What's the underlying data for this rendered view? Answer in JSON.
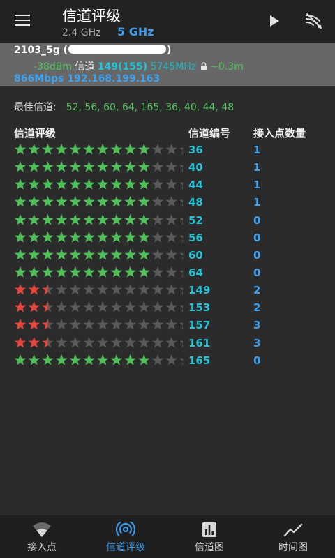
{
  "header": {
    "title": "信道评级",
    "band_24": "2.4 GHz",
    "band_5": "5 GHz",
    "icons": [
      "menu-icon",
      "play-icon",
      "wifi-scan-icon"
    ]
  },
  "connection": {
    "ssid_prefix": "2103_5g (",
    "ssid_suffix": ")",
    "signal": "-38dBm",
    "channel_label": "信道",
    "channel_value": "149(155)",
    "frequency": "5745MHz",
    "distance": "~0.3m",
    "link_speed": "866Mbps",
    "ip": "192.168.199.163"
  },
  "best_channels": {
    "label": "最佳信道:",
    "values": "52, 56, 60, 64, 165, 36, 40, 44, 48"
  },
  "table": {
    "col_rating": "信道评级",
    "col_channel": "信道编号",
    "col_count": "接入点数量",
    "rows": [
      {
        "rating": 10,
        "channel": "36",
        "count": "1"
      },
      {
        "rating": 10,
        "channel": "40",
        "count": "1"
      },
      {
        "rating": 10,
        "channel": "44",
        "count": "1"
      },
      {
        "rating": 10,
        "channel": "48",
        "count": "1"
      },
      {
        "rating": 10,
        "channel": "52",
        "count": "0"
      },
      {
        "rating": 10,
        "channel": "56",
        "count": "0"
      },
      {
        "rating": 10,
        "channel": "60",
        "count": "0"
      },
      {
        "rating": 10,
        "channel": "64",
        "count": "0"
      },
      {
        "rating": 2.5,
        "channel": "149",
        "count": "2"
      },
      {
        "rating": 2.5,
        "channel": "153",
        "count": "2"
      },
      {
        "rating": 2.5,
        "channel": "157",
        "count": "3"
      },
      {
        "rating": 2.5,
        "channel": "161",
        "count": "3"
      },
      {
        "rating": 10,
        "channel": "165",
        "count": "0"
      }
    ]
  },
  "colors": {
    "good_star": "#4fbf5a",
    "bad_star": "#e8453c",
    "empty_star": "#5a5a5a",
    "accent": "#3d9be9",
    "channel": "#22c4d8"
  },
  "nav": {
    "items": [
      {
        "label": "接入点",
        "icon": "wifi-icon",
        "active": false
      },
      {
        "label": "信道评级",
        "icon": "channel-rating-icon",
        "active": true
      },
      {
        "label": "信道图",
        "icon": "bar-chart-icon",
        "active": false
      },
      {
        "label": "时间图",
        "icon": "line-chart-icon",
        "active": false
      }
    ]
  }
}
